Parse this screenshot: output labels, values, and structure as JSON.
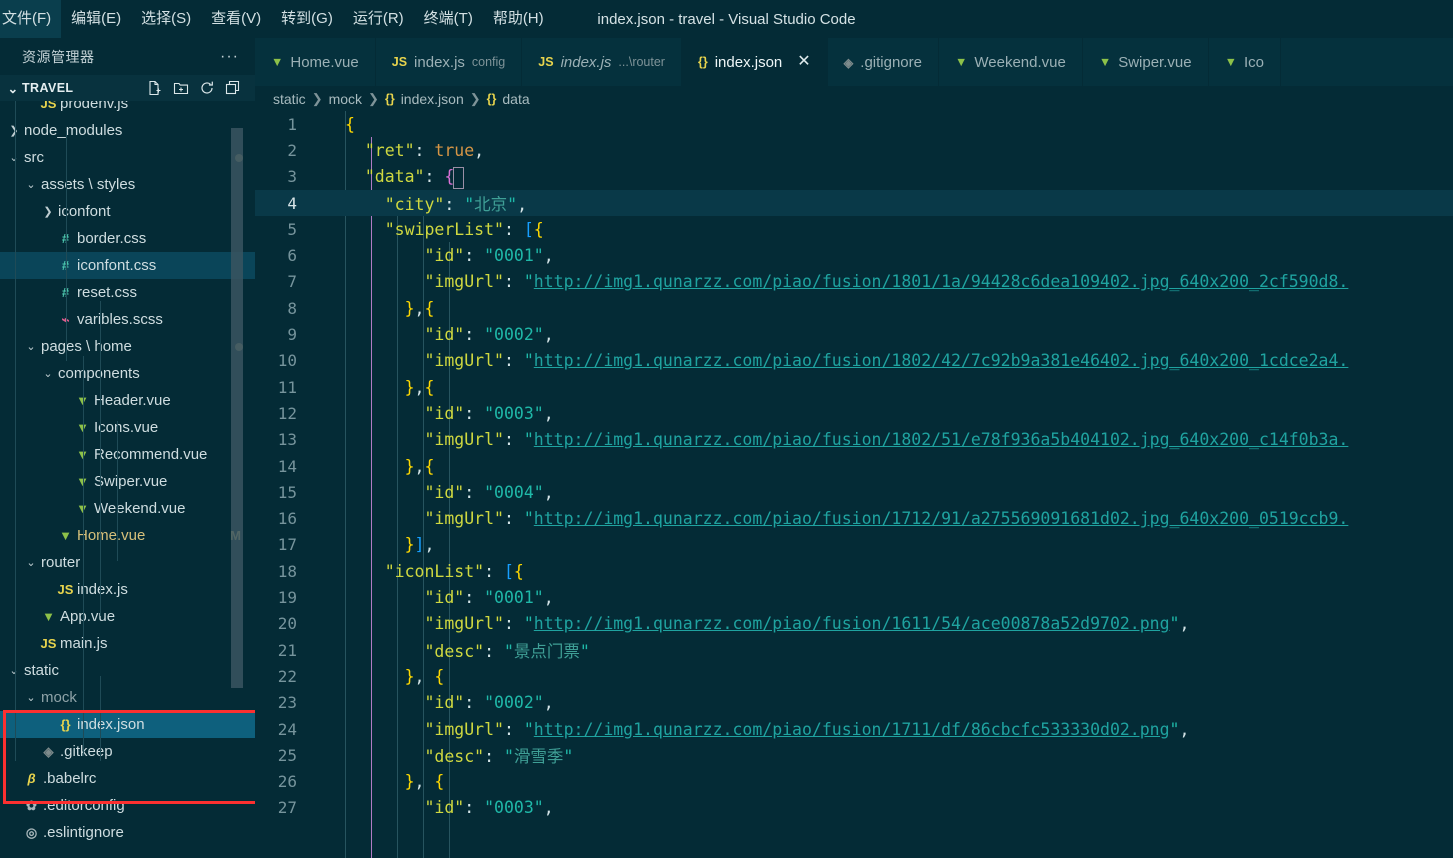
{
  "window": {
    "title": "index.json - travel - Visual Studio Code"
  },
  "menubar": {
    "items": [
      "文件(F)",
      "编辑(E)",
      "选择(S)",
      "查看(V)",
      "转到(G)",
      "运行(R)",
      "终端(T)",
      "帮助(H)"
    ]
  },
  "sidebar": {
    "header": "资源管理器",
    "more_label": "···",
    "project": {
      "name": "TRAVEL",
      "twisty": "⌄"
    },
    "actions": [
      "new-file",
      "new-folder",
      "refresh",
      "collapse-all"
    ],
    "tree": [
      {
        "label": "prodenv.js",
        "icon": "js",
        "depth": 2,
        "kind": "file",
        "partial": true
      },
      {
        "label": "node_modules",
        "icon": "none",
        "depth": 1,
        "kind": "folder",
        "chev": "›"
      },
      {
        "label": "src",
        "icon": "none",
        "depth": 1,
        "kind": "folder",
        "chev": "⌄",
        "dot": true
      },
      {
        "label": "assets \\ styles",
        "icon": "none",
        "depth": 2,
        "kind": "folder",
        "chev": "⌄"
      },
      {
        "label": "iconfont",
        "icon": "none",
        "depth": 3,
        "kind": "folder",
        "chev": "›"
      },
      {
        "label": "border.css",
        "icon": "#",
        "depth": 3,
        "kind": "file"
      },
      {
        "label": "iconfont.css",
        "icon": "#",
        "depth": 3,
        "kind": "file",
        "selected": true
      },
      {
        "label": "reset.css",
        "icon": "#",
        "depth": 3,
        "kind": "file"
      },
      {
        "label": "varibles.scss",
        "icon": "scss",
        "depth": 3,
        "kind": "file"
      },
      {
        "label": "pages \\ home",
        "icon": "none",
        "depth": 2,
        "kind": "folder",
        "chev": "⌄",
        "dot": true
      },
      {
        "label": "components",
        "icon": "none",
        "depth": 3,
        "kind": "folder",
        "chev": "⌄"
      },
      {
        "label": "Header.vue",
        "icon": "vue",
        "depth": 4,
        "kind": "file"
      },
      {
        "label": "Icons.vue",
        "icon": "vue",
        "depth": 4,
        "kind": "file"
      },
      {
        "label": "Recommend.vue",
        "icon": "vue",
        "depth": 4,
        "kind": "file"
      },
      {
        "label": "Swiper.vue",
        "icon": "vue",
        "depth": 4,
        "kind": "file"
      },
      {
        "label": "Weekend.vue",
        "icon": "vue",
        "depth": 4,
        "kind": "file"
      },
      {
        "label": "Home.vue",
        "icon": "vue",
        "depth": 3,
        "kind": "file",
        "badge": "M",
        "modified": true
      },
      {
        "label": "router",
        "icon": "none",
        "depth": 2,
        "kind": "folder",
        "chev": "⌄"
      },
      {
        "label": "index.js",
        "icon": "js",
        "depth": 3,
        "kind": "file"
      },
      {
        "label": "App.vue",
        "icon": "vue",
        "depth": 2,
        "kind": "file"
      },
      {
        "label": "main.js",
        "icon": "js",
        "depth": 2,
        "kind": "file"
      },
      {
        "label": "static",
        "icon": "none",
        "depth": 1,
        "kind": "folder",
        "chev": "⌄"
      },
      {
        "label": "mock",
        "icon": "none",
        "depth": 2,
        "kind": "folder",
        "chev": "⌄",
        "dim": true
      },
      {
        "label": "index.json",
        "icon": "json",
        "depth": 3,
        "kind": "file",
        "selected": true,
        "focus": true
      },
      {
        "label": ".gitkeep",
        "icon": "git",
        "depth": 2,
        "kind": "file"
      },
      {
        "label": ".babelrc",
        "icon": "babel",
        "depth": 1,
        "kind": "file"
      },
      {
        "label": ".editorconfig",
        "icon": "gear",
        "depth": 1,
        "kind": "file"
      },
      {
        "label": ".eslintignore",
        "icon": "circ",
        "depth": 1,
        "kind": "file",
        "partial": true
      }
    ],
    "annotation": {
      "color": "#fc3030",
      "targets": [
        "static",
        "mock",
        "index.json"
      ]
    }
  },
  "tabs": [
    {
      "name": "Home.vue",
      "icon": "vue",
      "desc": "",
      "active": false,
      "italic": false
    },
    {
      "name": "index.js",
      "icon": "js",
      "desc": "config",
      "active": false,
      "italic": false
    },
    {
      "name": "index.js",
      "icon": "js",
      "desc": "...\\router",
      "active": false,
      "italic": true
    },
    {
      "name": "index.json",
      "icon": "json",
      "desc": "",
      "active": true,
      "italic": false,
      "close": "✕"
    },
    {
      "name": ".gitignore",
      "icon": "git",
      "desc": "",
      "active": false,
      "italic": false
    },
    {
      "name": "Weekend.vue",
      "icon": "vue",
      "desc": "",
      "active": false,
      "italic": false
    },
    {
      "name": "Swiper.vue",
      "icon": "vue",
      "desc": "",
      "active": false,
      "italic": false
    },
    {
      "name": "Ico",
      "icon": "vue",
      "desc": "",
      "active": false,
      "italic": false
    }
  ],
  "breadcrumb": [
    {
      "text": "static",
      "icon": ""
    },
    {
      "text": "mock",
      "icon": ""
    },
    {
      "text": "index.json",
      "icon": "{}"
    },
    {
      "text": "data",
      "icon": "{}"
    }
  ],
  "editor": {
    "language": "json",
    "current_line": 4,
    "first_visible_line": 1,
    "lines": [
      {
        "n": 1,
        "segs": [
          {
            "t": "{",
            "c": "t-brace"
          }
        ]
      },
      {
        "n": 2,
        "segs": [
          {
            "t": "  ",
            "c": "t-punc"
          },
          {
            "t": "\"ret\"",
            "c": "t-keyy"
          },
          {
            "t": ": ",
            "c": "t-punc"
          },
          {
            "t": "true",
            "c": "t-bool"
          },
          {
            "t": ",",
            "c": "t-punc"
          }
        ]
      },
      {
        "n": 3,
        "segs": [
          {
            "t": "  ",
            "c": "t-punc"
          },
          {
            "t": "\"data\"",
            "c": "t-keyy"
          },
          {
            "t": ": ",
            "c": "t-punc"
          },
          {
            "t": "{",
            "c": "t-brace2"
          }
        ]
      },
      {
        "n": 4,
        "segs": [
          {
            "t": "    ",
            "c": "t-punc"
          },
          {
            "t": "\"city\"",
            "c": "t-keyy"
          },
          {
            "t": ": ",
            "c": "t-punc"
          },
          {
            "t": "\"",
            "c": "t-str"
          },
          {
            "t": "北京",
            "c": "t-cn"
          },
          {
            "t": "\"",
            "c": "t-str"
          },
          {
            "t": ",",
            "c": "t-punc"
          }
        ]
      },
      {
        "n": 5,
        "segs": [
          {
            "t": "    ",
            "c": "t-punc"
          },
          {
            "t": "\"swiperList\"",
            "c": "t-keyy"
          },
          {
            "t": ": ",
            "c": "t-punc"
          },
          {
            "t": "[",
            "c": "t-brace3"
          },
          {
            "t": "{",
            "c": "t-brace"
          }
        ]
      },
      {
        "n": 6,
        "segs": [
          {
            "t": "        ",
            "c": "t-punc"
          },
          {
            "t": "\"id\"",
            "c": "t-keyy"
          },
          {
            "t": ": ",
            "c": "t-punc"
          },
          {
            "t": "\"0001\"",
            "c": "t-str"
          },
          {
            "t": ",",
            "c": "t-punc"
          }
        ]
      },
      {
        "n": 7,
        "segs": [
          {
            "t": "        ",
            "c": "t-punc"
          },
          {
            "t": "\"imgUrl\"",
            "c": "t-keyy"
          },
          {
            "t": ": ",
            "c": "t-punc"
          },
          {
            "t": "\"",
            "c": "t-str"
          },
          {
            "t": "http://img1.qunarzz.com/piao/fusion/1801/1a/94428c6dea109402.jpg_640x200_2cf590d8.",
            "c": "t-url"
          }
        ]
      },
      {
        "n": 8,
        "segs": [
          {
            "t": "      ",
            "c": "t-punc"
          },
          {
            "t": "}",
            "c": "t-brace"
          },
          {
            "t": ",",
            "c": "t-punc"
          },
          {
            "t": "{",
            "c": "t-brace"
          }
        ]
      },
      {
        "n": 9,
        "segs": [
          {
            "t": "        ",
            "c": "t-punc"
          },
          {
            "t": "\"id\"",
            "c": "t-keyy"
          },
          {
            "t": ": ",
            "c": "t-punc"
          },
          {
            "t": "\"0002\"",
            "c": "t-str"
          },
          {
            "t": ",",
            "c": "t-punc"
          }
        ]
      },
      {
        "n": 10,
        "segs": [
          {
            "t": "        ",
            "c": "t-punc"
          },
          {
            "t": "\"imgUrl\"",
            "c": "t-keyy"
          },
          {
            "t": ": ",
            "c": "t-punc"
          },
          {
            "t": "\"",
            "c": "t-str"
          },
          {
            "t": "http://img1.qunarzz.com/piao/fusion/1802/42/7c92b9a381e46402.jpg_640x200_1cdce2a4.",
            "c": "t-url"
          }
        ]
      },
      {
        "n": 11,
        "segs": [
          {
            "t": "      ",
            "c": "t-punc"
          },
          {
            "t": "}",
            "c": "t-brace"
          },
          {
            "t": ",",
            "c": "t-punc"
          },
          {
            "t": "{",
            "c": "t-brace"
          }
        ]
      },
      {
        "n": 12,
        "segs": [
          {
            "t": "        ",
            "c": "t-punc"
          },
          {
            "t": "\"id\"",
            "c": "t-keyy"
          },
          {
            "t": ": ",
            "c": "t-punc"
          },
          {
            "t": "\"0003\"",
            "c": "t-str"
          },
          {
            "t": ",",
            "c": "t-punc"
          }
        ]
      },
      {
        "n": 13,
        "segs": [
          {
            "t": "        ",
            "c": "t-punc"
          },
          {
            "t": "\"imgUrl\"",
            "c": "t-keyy"
          },
          {
            "t": ": ",
            "c": "t-punc"
          },
          {
            "t": "\"",
            "c": "t-str"
          },
          {
            "t": "http://img1.qunarzz.com/piao/fusion/1802/51/e78f936a5b404102.jpg_640x200_c14f0b3a.",
            "c": "t-url"
          }
        ]
      },
      {
        "n": 14,
        "segs": [
          {
            "t": "      ",
            "c": "t-punc"
          },
          {
            "t": "}",
            "c": "t-brace"
          },
          {
            "t": ",",
            "c": "t-punc"
          },
          {
            "t": "{",
            "c": "t-brace"
          }
        ]
      },
      {
        "n": 15,
        "segs": [
          {
            "t": "        ",
            "c": "t-punc"
          },
          {
            "t": "\"id\"",
            "c": "t-keyy"
          },
          {
            "t": ": ",
            "c": "t-punc"
          },
          {
            "t": "\"0004\"",
            "c": "t-str"
          },
          {
            "t": ",",
            "c": "t-punc"
          }
        ]
      },
      {
        "n": 16,
        "segs": [
          {
            "t": "        ",
            "c": "t-punc"
          },
          {
            "t": "\"imgUrl\"",
            "c": "t-keyy"
          },
          {
            "t": ": ",
            "c": "t-punc"
          },
          {
            "t": "\"",
            "c": "t-str"
          },
          {
            "t": "http://img1.qunarzz.com/piao/fusion/1712/91/a275569091681d02.jpg_640x200_0519ccb9.",
            "c": "t-url"
          }
        ]
      },
      {
        "n": 17,
        "segs": [
          {
            "t": "      ",
            "c": "t-punc"
          },
          {
            "t": "}",
            "c": "t-brace"
          },
          {
            "t": "]",
            "c": "t-brace3"
          },
          {
            "t": ",",
            "c": "t-punc"
          }
        ]
      },
      {
        "n": 18,
        "segs": [
          {
            "t": "    ",
            "c": "t-punc"
          },
          {
            "t": "\"iconList\"",
            "c": "t-keyy"
          },
          {
            "t": ": ",
            "c": "t-punc"
          },
          {
            "t": "[",
            "c": "t-brace3"
          },
          {
            "t": "{",
            "c": "t-brace"
          }
        ]
      },
      {
        "n": 19,
        "segs": [
          {
            "t": "        ",
            "c": "t-punc"
          },
          {
            "t": "\"id\"",
            "c": "t-keyy"
          },
          {
            "t": ": ",
            "c": "t-punc"
          },
          {
            "t": "\"0001\"",
            "c": "t-str"
          },
          {
            "t": ",",
            "c": "t-punc"
          }
        ]
      },
      {
        "n": 20,
        "segs": [
          {
            "t": "        ",
            "c": "t-punc"
          },
          {
            "t": "\"imgUrl\"",
            "c": "t-keyy"
          },
          {
            "t": ": ",
            "c": "t-punc"
          },
          {
            "t": "\"",
            "c": "t-str"
          },
          {
            "t": "http://img1.qunarzz.com/piao/fusion/1611/54/ace00878a52d9702.png",
            "c": "t-url"
          },
          {
            "t": "\"",
            "c": "t-str"
          },
          {
            "t": ",",
            "c": "t-punc"
          }
        ]
      },
      {
        "n": 21,
        "segs": [
          {
            "t": "        ",
            "c": "t-punc"
          },
          {
            "t": "\"desc\"",
            "c": "t-keyy"
          },
          {
            "t": ": ",
            "c": "t-punc"
          },
          {
            "t": "\"",
            "c": "t-str"
          },
          {
            "t": "景点门票",
            "c": "t-cn"
          },
          {
            "t": "\"",
            "c": "t-str"
          }
        ]
      },
      {
        "n": 22,
        "segs": [
          {
            "t": "      ",
            "c": "t-punc"
          },
          {
            "t": "}",
            "c": "t-brace"
          },
          {
            "t": ", ",
            "c": "t-punc"
          },
          {
            "t": "{",
            "c": "t-brace"
          }
        ]
      },
      {
        "n": 23,
        "segs": [
          {
            "t": "        ",
            "c": "t-punc"
          },
          {
            "t": "\"id\"",
            "c": "t-keyy"
          },
          {
            "t": ": ",
            "c": "t-punc"
          },
          {
            "t": "\"0002\"",
            "c": "t-str"
          },
          {
            "t": ",",
            "c": "t-punc"
          }
        ]
      },
      {
        "n": 24,
        "segs": [
          {
            "t": "        ",
            "c": "t-punc"
          },
          {
            "t": "\"imgUrl\"",
            "c": "t-keyy"
          },
          {
            "t": ": ",
            "c": "t-punc"
          },
          {
            "t": "\"",
            "c": "t-str"
          },
          {
            "t": "http://img1.qunarzz.com/piao/fusion/1711/df/86cbcfc533330d02.png",
            "c": "t-url"
          },
          {
            "t": "\"",
            "c": "t-str"
          },
          {
            "t": ",",
            "c": "t-punc"
          }
        ]
      },
      {
        "n": 25,
        "segs": [
          {
            "t": "        ",
            "c": "t-punc"
          },
          {
            "t": "\"desc\"",
            "c": "t-keyy"
          },
          {
            "t": ": ",
            "c": "t-punc"
          },
          {
            "t": "\"",
            "c": "t-str"
          },
          {
            "t": "滑雪季",
            "c": "t-cn"
          },
          {
            "t": "\"",
            "c": "t-str"
          }
        ]
      },
      {
        "n": 26,
        "segs": [
          {
            "t": "      ",
            "c": "t-punc"
          },
          {
            "t": "}",
            "c": "t-brace"
          },
          {
            "t": ", ",
            "c": "t-punc"
          },
          {
            "t": "{",
            "c": "t-brace"
          }
        ]
      },
      {
        "n": 27,
        "segs": [
          {
            "t": "        ",
            "c": "t-punc"
          },
          {
            "t": "\"id\"",
            "c": "t-keyy"
          },
          {
            "t": ": ",
            "c": "t-punc"
          },
          {
            "t": "\"0003\"",
            "c": "t-str"
          },
          {
            "t": ",",
            "c": "t-punc"
          }
        ]
      }
    ]
  },
  "colors": {
    "bg": "#042b36",
    "tabbar_bg": "#05313d",
    "selected_row": "#0e607d",
    "annotation_red": "#fc3030",
    "vue_green": "#8dc149",
    "json_yellow": "#e8d44d"
  }
}
